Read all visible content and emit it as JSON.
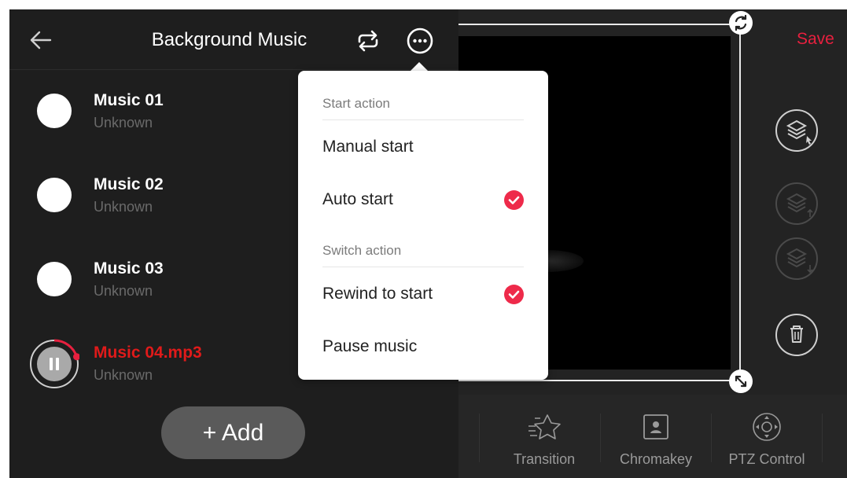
{
  "header": {
    "title": "Background Music"
  },
  "playlist": [
    {
      "name": "Music 01",
      "artist": "Unknown"
    },
    {
      "name": "Music 02",
      "artist": "Unknown"
    },
    {
      "name": "Music 03",
      "artist": "Unknown"
    },
    {
      "name": "Music 04.mp3",
      "artist": "Unknown",
      "playing": true,
      "progress": 0.3
    }
  ],
  "add_button": {
    "label": "+ Add"
  },
  "save": {
    "label": "Save"
  },
  "menu": {
    "start_section": "Start action",
    "manual_start": "Manual start",
    "auto_start": "Auto start",
    "switch_section": "Switch action",
    "rewind": "Rewind to start",
    "pause": "Pause music",
    "checked": [
      "Auto start",
      "Rewind to start"
    ]
  },
  "toolbar": {
    "transition": "Transition",
    "chromakey": "Chromakey",
    "ptz": "PTZ Control"
  },
  "colors": {
    "accent": "#e8203f",
    "panel": "#1e1e1e",
    "playing_text": "#e01a1a"
  },
  "icons": [
    "back-arrow-icon",
    "loop-icon",
    "more-icon",
    "pause-icon",
    "rotate-icon",
    "resize-icon",
    "layers-select-icon",
    "layer-up-icon",
    "layer-down-icon",
    "trash-icon",
    "transition-star-icon",
    "chromakey-icon",
    "ptz-dpad-icon",
    "check-icon"
  ]
}
